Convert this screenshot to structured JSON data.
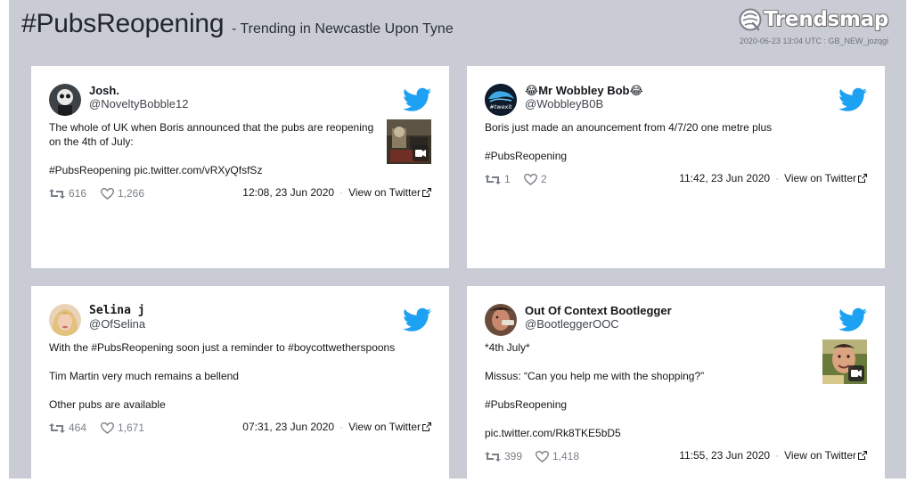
{
  "header": {
    "hashtag": "#PubsReopening",
    "subtitle": "- Trending in Newcastle Upon Tyne",
    "brand": "Trendsmap",
    "timestamp": "2020-06-23 13:04 UTC : GB_NEW_jozqgi"
  },
  "colors": {
    "twitter_blue": "#1da1f2",
    "background": "#c9ccd4",
    "card": "#ffffff"
  },
  "tweets": [
    {
      "name": "Josh.",
      "handle": "@NoveltyBobble12",
      "lines": [
        "The whole of UK when Boris announced that the pubs are reopening on the 4th of July:",
        "#PubsReopening pic.twitter.com/vRXyQfsfSz"
      ],
      "retweets": "616",
      "likes": "1,266",
      "time": "12:08, 23 Jun 2020",
      "view_label": "View on Twitter",
      "has_video": true
    },
    {
      "name": "😂Mr Wobbley Bob😂",
      "handle": "@WobbleyB0B",
      "lines": [
        "Boris just made an anouncement from 4/7/20 one metre plus",
        "#PubsReopening"
      ],
      "retweets": "1",
      "likes": "2",
      "time": "11:42, 23 Jun 2020",
      "view_label": "View on Twitter",
      "avatar_text": "#twexit",
      "has_video": false
    },
    {
      "name": "Selina j",
      "handle": "@OfSelina",
      "lines": [
        "With the #PubsReopening soon just a reminder to #boycottwetherspoons",
        "Tim Martin very much remains a bellend",
        "Other pubs are available"
      ],
      "retweets": "464",
      "likes": "1,671",
      "time": "07:31, 23 Jun 2020",
      "view_label": "View on Twitter",
      "has_video": false
    },
    {
      "name": "Out Of Context Bootlegger",
      "handle": "@BootleggerOOC",
      "lines": [
        "*4th July*",
        "Missus: “Can you help me with the shopping?”",
        "#PubsReopening",
        "pic.twitter.com/Rk8TKE5bD5"
      ],
      "retweets": "399",
      "likes": "1,418",
      "time": "11:55, 23 Jun 2020",
      "view_label": "View on Twitter",
      "has_video": true
    }
  ]
}
